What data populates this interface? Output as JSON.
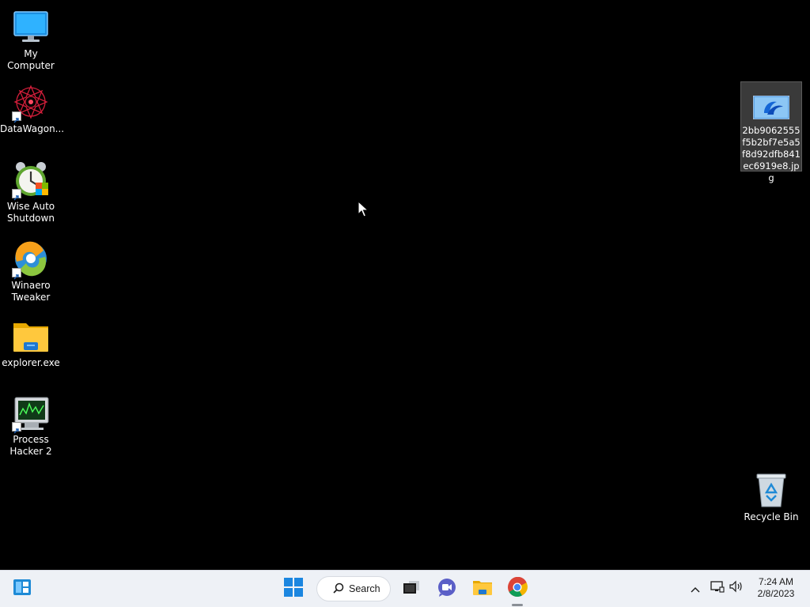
{
  "desktop": {
    "icons_left": [
      {
        "label": "My Computer",
        "icon": "monitor-icon",
        "shortcut": false
      },
      {
        "label": "DataWagon...",
        "icon": "datawagon-icon",
        "shortcut": true
      },
      {
        "label": "Wise Auto\nShutdown",
        "icon": "alarm-clock-icon",
        "shortcut": true
      },
      {
        "label": "Winaero\nTweaker",
        "icon": "winaero-icon",
        "shortcut": true
      },
      {
        "label": "explorer.exe",
        "icon": "folder-icon",
        "shortcut": false
      },
      {
        "label": "Process\nHacker 2",
        "icon": "process-monitor-icon",
        "shortcut": true
      }
    ],
    "selected_file": {
      "label": "2bb9062555f5b2bf7e5a5f8d92dfb841ec6919e8.jpg",
      "icon": "image-file-icon"
    },
    "recycle_bin": {
      "label": "Recycle Bin",
      "icon": "recycle-bin-icon"
    }
  },
  "taskbar": {
    "widgets_icon": "widgets-icon",
    "start_icon": "windows-start-icon",
    "search": {
      "label": "Search",
      "icon": "search-icon"
    },
    "pinned": [
      {
        "name": "task-view",
        "icon": "task-view-icon"
      },
      {
        "name": "teams-chat",
        "icon": "chat-camera-icon"
      },
      {
        "name": "file-explorer",
        "icon": "folder-icon"
      },
      {
        "name": "chrome",
        "icon": "chrome-icon"
      }
    ],
    "tray": {
      "icons": [
        "chevron-up-icon",
        "network-icon",
        "speaker-icon"
      ],
      "time": "7:24 AM",
      "date": "2/8/2023"
    }
  },
  "colors": {
    "desktop_bg": "#000000",
    "taskbar_bg": "#eef1f6",
    "accent": "#0a74d8"
  }
}
